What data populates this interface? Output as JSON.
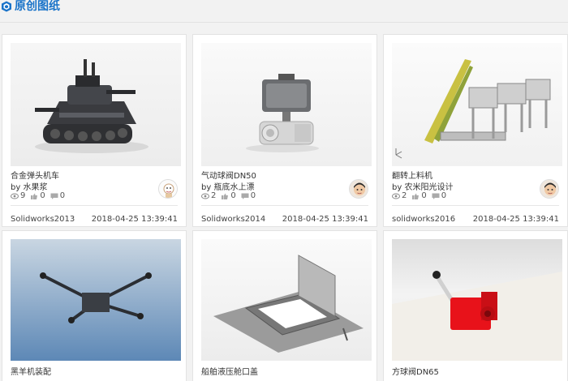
{
  "section": {
    "title": "原创图纸"
  },
  "cards": [
    {
      "name": "合金弹头机车",
      "author": "by 水果浆",
      "views": "9",
      "likes": "0",
      "comments": "0",
      "software": "Solidworks2013",
      "date": "2018-04-25 13:39:41"
    },
    {
      "name": "气动球阀DN50",
      "author": "by 瓶底水上漂",
      "views": "2",
      "likes": "0",
      "comments": "0",
      "software": "Solidworks2014",
      "date": "2018-04-25 13:39:41"
    },
    {
      "name": "翻转上料机",
      "author": "by 农米阳光设计",
      "views": "2",
      "likes": "0",
      "comments": "0",
      "software": "solidworks2016",
      "date": "2018-04-25 13:39:41"
    },
    {
      "name": "黑羊机装配",
      "author": "",
      "views": "",
      "likes": "",
      "comments": "",
      "software": "",
      "date": ""
    },
    {
      "name": "船舶液压舱口盖",
      "author": "",
      "views": "",
      "likes": "",
      "comments": "",
      "software": "",
      "date": ""
    },
    {
      "name": "方球阀DN65",
      "author": "",
      "views": "",
      "likes": "",
      "comments": "",
      "software": "",
      "date": ""
    }
  ],
  "colors": {
    "accent": "#1a73c9",
    "valve_red": "#e8121a"
  }
}
